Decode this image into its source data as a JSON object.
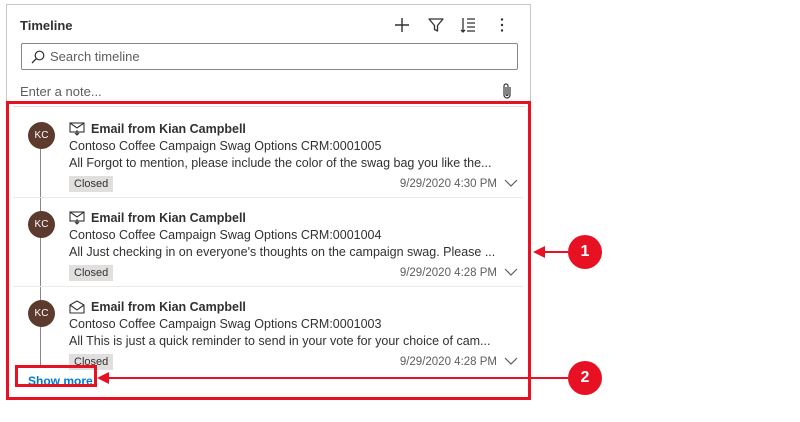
{
  "timeline": {
    "title": "Timeline",
    "toolbar": {
      "add_icon": "plus-icon",
      "filter_icon": "filter-icon",
      "sort_icon": "sort-icon",
      "more_icon": "more-vertical-icon"
    },
    "search_placeholder": "Search timeline",
    "note_placeholder": "Enter a note...",
    "items": [
      {
        "avatar": "KC",
        "icon": "email-received-icon",
        "title": "Email from Kian Campbell",
        "subject": "Contoso Coffee Campaign Swag Options CRM:0001005",
        "body": "All Forgot to mention, please include the color of the swag bag you like the...",
        "status": "Closed",
        "timestamp": "9/29/2020 4:30 PM"
      },
      {
        "avatar": "KC",
        "icon": "email-received-icon",
        "title": "Email from Kian Campbell",
        "subject": "Contoso Coffee Campaign Swag Options CRM:0001004",
        "body": "All Just checking in on everyone's thoughts on the campaign swag.   Please ...",
        "status": "Closed",
        "timestamp": "9/29/2020 4:28 PM"
      },
      {
        "avatar": "KC",
        "icon": "email-open-icon",
        "title": "Email from Kian Campbell",
        "subject": "Contoso Coffee Campaign Swag Options CRM:0001003",
        "body": "All This is just a quick reminder to send in your vote for your choice of cam...",
        "status": "Closed",
        "timestamp": "9/29/2020 4:28 PM"
      }
    ],
    "show_more": "Show more"
  },
  "callouts": [
    {
      "number": "1"
    },
    {
      "number": "2"
    }
  ],
  "colors": {
    "accent": "#0078d4",
    "callout": "#e81123",
    "avatar": "#5c3a2e"
  }
}
